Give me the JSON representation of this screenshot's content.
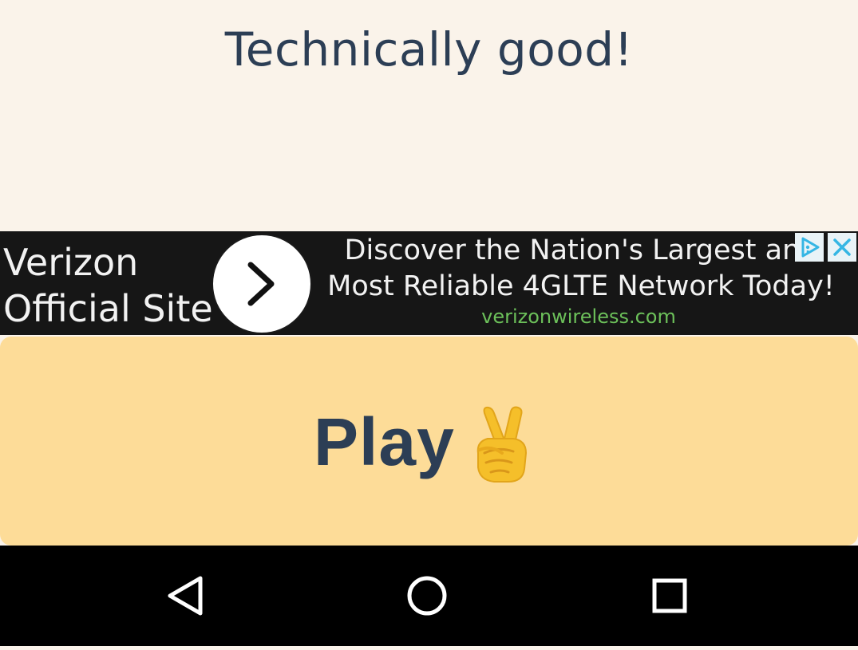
{
  "result": {
    "title": "Technically good!"
  },
  "ad": {
    "advertiser_line1": "Verizon",
    "advertiser_line2": "Official Site",
    "headline_line1": "Discover the Nation's Largest and",
    "headline_line2": "Most Reliable 4GLTE Network Today!",
    "url": "verizonwireless.com",
    "icons": [
      "chevron-right-icon",
      "adchoices-icon",
      "close-icon"
    ],
    "colors": {
      "background": "#161616",
      "text": "#f2f2f2",
      "url": "#6cc05a",
      "adchoices": "#35b6e4"
    }
  },
  "play": {
    "label": "Play",
    "icon": "peace-hand-icon",
    "colors": {
      "background": "#fddc98",
      "text": "#2c3e55"
    }
  },
  "navigation": {
    "icons": [
      "back-icon",
      "home-icon",
      "recents-icon"
    ]
  },
  "colors": {
    "page_background": "#faf3ea",
    "title_text": "#2c3e55",
    "nav_background": "#000000"
  }
}
